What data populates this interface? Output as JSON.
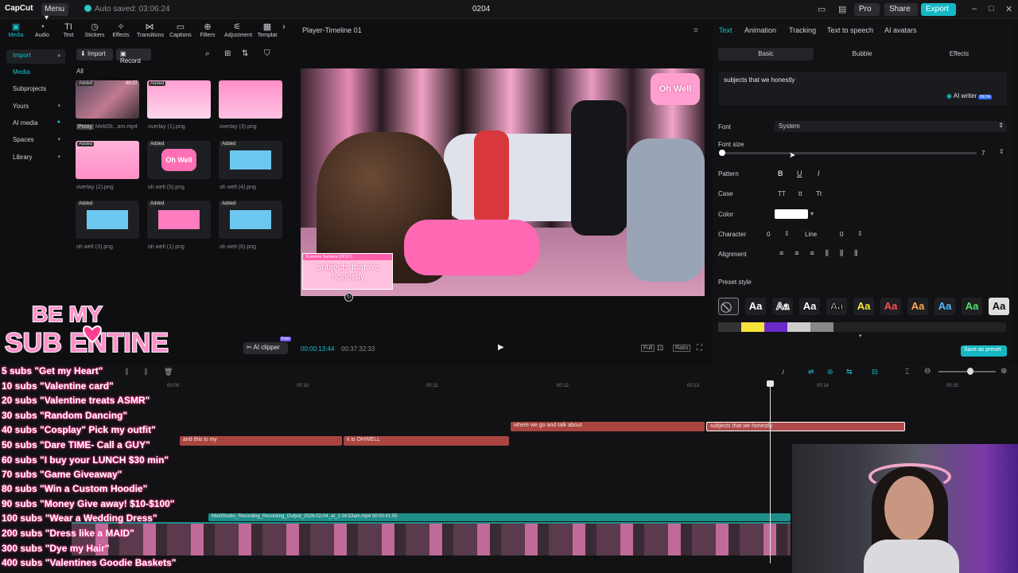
{
  "app": {
    "logo": "CapCut",
    "menu": "Menu",
    "autosave": "Auto saved: 03:06:24",
    "project": "0204",
    "pro": "Pro",
    "share": "Share",
    "export": "Export"
  },
  "tools": [
    "Media",
    "Audio",
    "Text",
    "Stickers",
    "Effects",
    "Transitions",
    "Captions",
    "Filters",
    "Adjustment",
    "Templat"
  ],
  "nav": {
    "import": "Import",
    "media": "Media",
    "subprojects": "Subprojects",
    "yours": "Yours",
    "ai_media": "AI media",
    "spaces": "Spaces",
    "library": "Library"
  },
  "media_panel": {
    "import_btn": "Import",
    "record_btn": "Record",
    "all": "All",
    "added": "Added",
    "proxy": "Proxy",
    "duration": "40:37",
    "items": [
      "MeldSt...am.mp4",
      "overlay (1).png",
      "overlay (3).png",
      "overlay (2).png",
      "oh well (5).png",
      "oh well (4).png",
      "oh well (3).png",
      "oh well (1).png",
      "oh well (6).png"
    ],
    "ai_clipper": "AI clipper",
    "free": "Free"
  },
  "player": {
    "title": "Player-Timeline 01",
    "caption": "subjects that we honestly",
    "name_tag": "Eyvonne Santana (HOST)",
    "current": "00:00:13:44",
    "total": "00:37:32:33",
    "full": "Full",
    "ratio": "Ratio"
  },
  "right_panel": {
    "tabs": [
      "Text",
      "Animation",
      "Tracking",
      "Text to speech",
      "AI avatars"
    ],
    "subtabs": [
      "Basic",
      "Bubble",
      "Effects"
    ],
    "text_value": "subjects that we honestly",
    "ai_writer": "AI writer",
    "beta": "BETA",
    "font_label": "Font",
    "font_value": "System",
    "font_size_label": "Font size",
    "font_size_value": "7",
    "font_size_level": 0.01,
    "pattern_label": "Pattern",
    "case_label": "Case",
    "case_options": [
      "TT",
      "tt",
      "Tt"
    ],
    "color_label": "Color",
    "character_label": "Character",
    "character_value": "0",
    "line_label": "Line",
    "line_value": "0",
    "alignment_label": "Alignment",
    "preset_label": "Preset style",
    "preset_sample": "Aa",
    "save_preset": "Save as preset"
  },
  "timeline": {
    "ruler": [
      "00:09",
      "00:10",
      "00:11",
      "00:12",
      "00:13",
      "00:14",
      "00:15"
    ],
    "clips": {
      "c1": "where we go and talk about",
      "c2": "subjects that we honestly",
      "c3": "and this is my",
      "c4": "it is OHWELL",
      "video": "MeldStudio_Recording_Recording_Output_2026-02-04_at_2.34.53am.mp4  00:00:41:55"
    }
  },
  "overlay": {
    "logo_line1": "BE MY",
    "logo_line2": "SUB ENTINE",
    "goals": [
      "5 subs \"Get my Heart\"",
      "10 subs \"Valentine card\"",
      "20 subs \"Valentine treats ASMR\"",
      "30 subs \"Random Dancing\"",
      "40 subs \"Cosplay\" Pick my outfit\"",
      "50 subs \"Dare TIME- Call a GUY\"",
      "60 subs \"I buy your LUNCH $30 min\"",
      "70 subs \"Game Giveaway\"",
      "80 subs \"Win a Custom Hoodie\"",
      "90 subs \"Money Give away! $10-$100\"",
      "100 subs \"Wear a Wedding Dress\"",
      "200 subs \"Dress like a MAID\"",
      "300 subs \"Dye my Hair\"",
      "400 subs \"Valentines Goodie Baskets\""
    ]
  },
  "colors": {
    "accent": "#18c2cc",
    "clip": "#b04a4a",
    "video_track": "#1f8f8a",
    "overlay_pink": "#ff2b8a"
  }
}
